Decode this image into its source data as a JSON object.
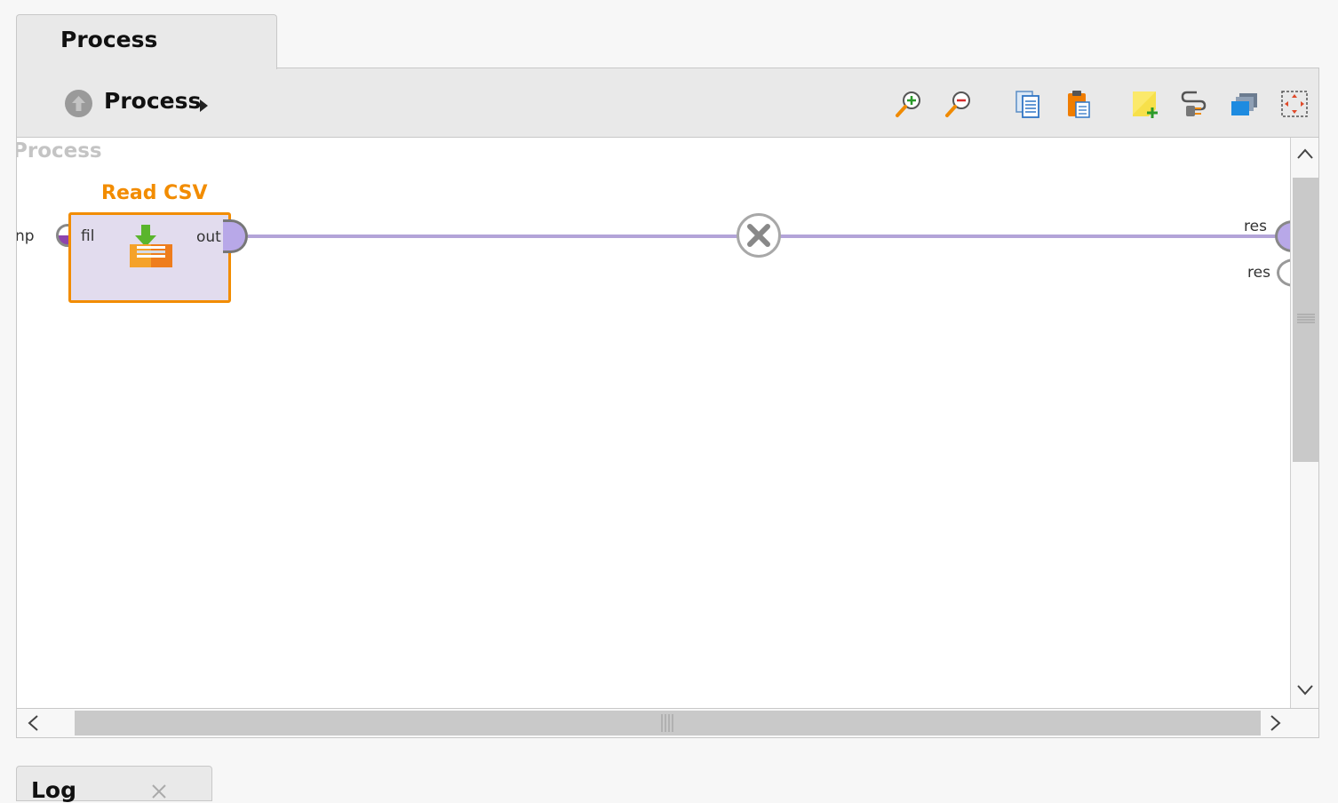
{
  "tabs": {
    "process_tab": "Process",
    "log_tab": "Log"
  },
  "breadcrumb": {
    "current": "Process"
  },
  "toolbar": {
    "buttons": [
      {
        "icon": "zoom-in-icon"
      },
      {
        "icon": "zoom-out-icon"
      },
      {
        "icon": "copy-icon"
      },
      {
        "icon": "paste-icon"
      },
      {
        "icon": "add-note-icon"
      },
      {
        "icon": "auto-wire-icon"
      },
      {
        "icon": "arrange-layers-icon"
      },
      {
        "icon": "fit-to-view-icon"
      }
    ]
  },
  "canvas": {
    "watermark": "Process",
    "input_port_label": "np",
    "operator": {
      "title": "Read CSV",
      "in_port": "fil",
      "out_port": "out",
      "icon": "read-csv-icon"
    },
    "result_ports": [
      "res",
      "res"
    ]
  },
  "colors": {
    "operator_border": "#f28c00",
    "operator_fill": "#e2dcee",
    "connection": "#b3a4d8"
  }
}
